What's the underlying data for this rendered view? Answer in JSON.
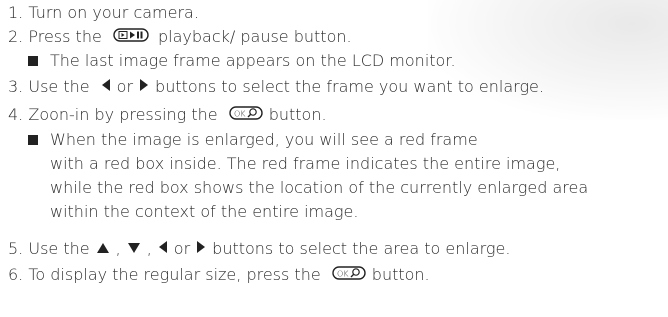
{
  "steps": {
    "s1": {
      "text": "1. Turn on your camera."
    },
    "s2": {
      "pre": "2. Press the ",
      "post": " playback/ pause button."
    },
    "s2_bullet": {
      "text": "The last image frame appears on the LCD monitor."
    },
    "s3": {
      "pre": "3. Use the ",
      "mid": "or",
      "post": "buttons to select the frame you want to enlarge."
    },
    "s4": {
      "pre": "4. Zoon-in by pressing the ",
      "post": "button."
    },
    "s4_bullet": {
      "l1": "When the image is enlarged, you will see a red frame",
      "l2": "with a red box inside. The red frame indicates the entire image,",
      "l3": "while the red box shows the location of the currently enlarged area",
      "l4": "within the context of the entire image."
    },
    "s5": {
      "pre": "5. Use the",
      "sep1": ",",
      "sep2": ",",
      "mid": "or",
      "post": "buttons to select the area to enlarge."
    },
    "s6": {
      "pre": "6. To display the regular size, press the ",
      "post": "button."
    }
  },
  "icons": {
    "playback_pause": "playback-pause-button-icon",
    "ok_zoom": "ok-zoom-button-icon",
    "left": "left-arrow-icon",
    "right": "right-arrow-icon",
    "up": "up-arrow-icon",
    "down": "down-arrow-icon"
  }
}
